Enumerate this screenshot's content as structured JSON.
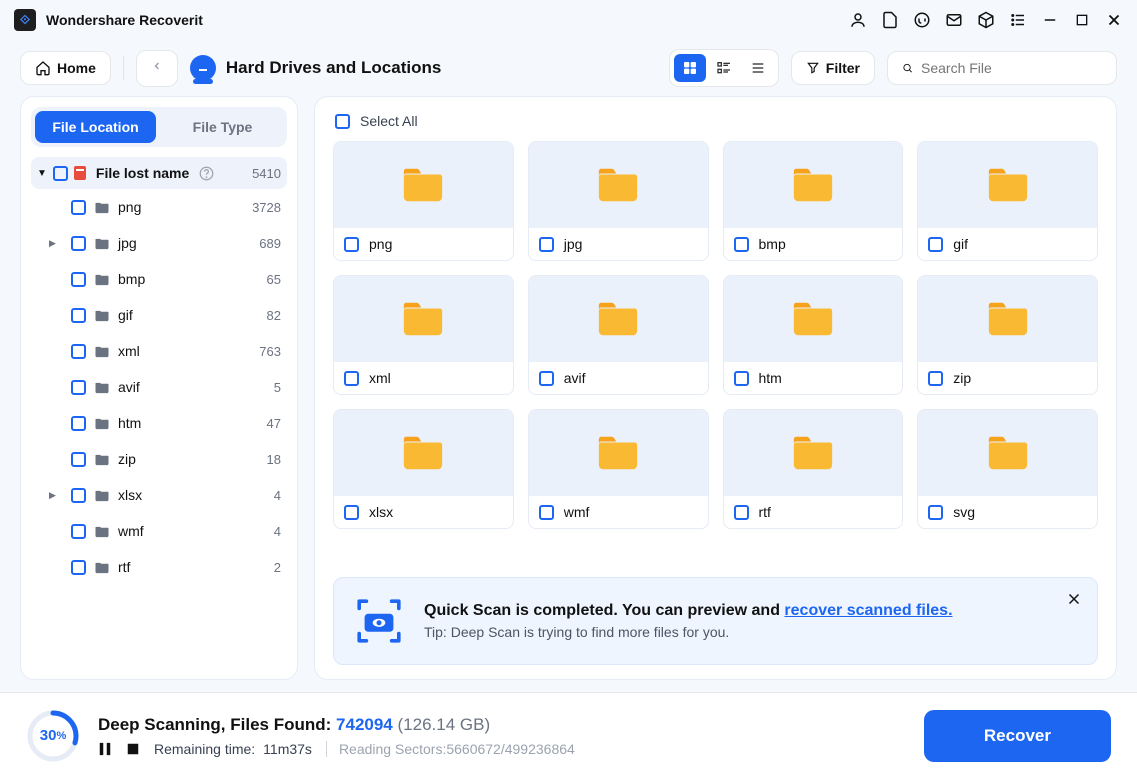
{
  "app_title": "Wondershare Recoverit",
  "toolbar": {
    "home_label": "Home",
    "location": "Hard Drives and Locations",
    "filter_label": "Filter",
    "search_placeholder": "Search File"
  },
  "sidebar": {
    "tabs": {
      "location": "File Location",
      "type": "File Type"
    },
    "root": {
      "label": "File lost name",
      "count": "5410"
    },
    "items": [
      {
        "label": "png",
        "count": "3728",
        "has_children": false
      },
      {
        "label": "jpg",
        "count": "689",
        "has_children": true
      },
      {
        "label": "bmp",
        "count": "65",
        "has_children": false
      },
      {
        "label": "gif",
        "count": "82",
        "has_children": false
      },
      {
        "label": "xml",
        "count": "763",
        "has_children": false
      },
      {
        "label": "avif",
        "count": "5",
        "has_children": false
      },
      {
        "label": "htm",
        "count": "47",
        "has_children": false
      },
      {
        "label": "zip",
        "count": "18",
        "has_children": false
      },
      {
        "label": "xlsx",
        "count": "4",
        "has_children": true
      },
      {
        "label": "wmf",
        "count": "4",
        "has_children": false
      },
      {
        "label": "rtf",
        "count": "2",
        "has_children": false
      }
    ]
  },
  "content": {
    "select_all": "Select All",
    "folders": [
      "png",
      "jpg",
      "bmp",
      "gif",
      "xml",
      "avif",
      "htm",
      "zip",
      "xlsx",
      "wmf",
      "rtf",
      "svg"
    ]
  },
  "notification": {
    "title_part1": "Quick Scan is completed. You can preview and ",
    "title_link": "recover scanned files.",
    "tip": "Tip: Deep Scan is trying to find more files for you."
  },
  "status": {
    "percent": "30",
    "percent_suffix": "%",
    "label": "Deep Scanning, Files Found: ",
    "files_found": "742094",
    "size": "(126.14 GB)",
    "remaining_label": "Remaining time:",
    "remaining_value": "11m37s",
    "sectors_label": "Reading Sectors:",
    "sectors_value": "5660672/499236864",
    "recover_label": "Recover"
  }
}
